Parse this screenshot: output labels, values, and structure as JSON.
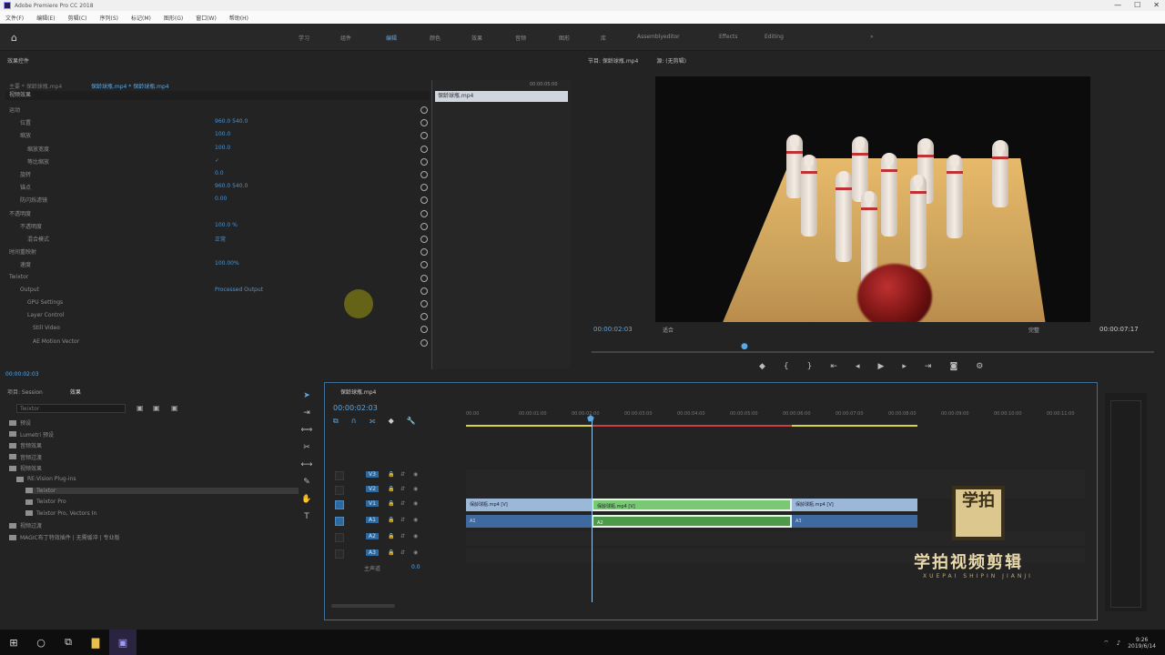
{
  "window": {
    "title": "Adobe Premiere Pro CC 2018",
    "controls": [
      "—",
      "☐",
      "✕"
    ]
  },
  "menu": [
    "文件(F)",
    "编辑(E)",
    "剪辑(C)",
    "序列(S)",
    "标记(M)",
    "图形(G)",
    "窗口(W)",
    "帮助(H)"
  ],
  "workspaces": {
    "tabs": [
      "学习",
      "组件",
      "编辑",
      "颜色",
      "效果",
      "音频",
      "图形",
      "库",
      "Assemblyeditor",
      "Effects",
      "Editing"
    ],
    "active_index": 2
  },
  "effect_controls": {
    "title": "效果控件",
    "source_clip": "主要 * 保龄球瓶.mp4",
    "sequence_clip": "保龄球瓶.mp4 * 保龄球瓶.mp4",
    "section": "视频效果",
    "rows": [
      {
        "label": "运动",
        "value": ""
      },
      {
        "label": "位置",
        "value": "960.0   540.0"
      },
      {
        "label": "缩放",
        "value": "100.0"
      },
      {
        "label": "缩放宽度",
        "value": "100.0"
      },
      {
        "label": "等比缩放",
        "value": "✓"
      },
      {
        "label": "旋转",
        "value": "0.0"
      },
      {
        "label": "锚点",
        "value": "960.0   540.0"
      },
      {
        "label": "防闪烁滤镜",
        "value": "0.00"
      },
      {
        "label": "不透明度",
        "value": ""
      },
      {
        "label": "不透明度",
        "value": "100.0 %"
      },
      {
        "label": "混合模式",
        "value": "正常"
      },
      {
        "label": "时间重映射",
        "value": ""
      },
      {
        "label": "速度",
        "value": "100.00%"
      },
      {
        "label": "Twixtor",
        "value": ""
      },
      {
        "label": "Output",
        "value": "Processed Output"
      },
      {
        "label": "GPU Settings",
        "value": ""
      },
      {
        "label": "Layer Control",
        "value": ""
      },
      {
        "label": "Still Video",
        "value": ""
      },
      {
        "label": "AE Motion Vector",
        "value": ""
      }
    ],
    "timecode": "00:00:02:03",
    "mini_clip": "保龄球瓶.mp4",
    "mini_timecode": "00:00:05:00"
  },
  "program": {
    "tab": "节目: 保龄球瓶.mp4",
    "tab2": "源: (无剪辑)",
    "timecode_in": "00:00:02:03",
    "fit": "适合",
    "quality": "完整",
    "duration": "00:00:07:17"
  },
  "project": {
    "tabs": [
      "项目: Session",
      "效果"
    ],
    "search_placeholder": "Twixtor",
    "items": [
      "预设",
      "Lumetri 预设",
      "音频效果",
      "音频过渡",
      "视频效果",
      "RE:Vision Plug-ins",
      "Twixtor",
      "Twixtor Pro",
      "Twixtor Pro, Vectors In",
      "视频过渡",
      "MAGIC布丁特效插件 | 无需缓冲 | 专业版"
    ]
  },
  "timeline": {
    "title": "保龄球瓶.mp4",
    "timecode": "00:00:02:03",
    "ruler": [
      "00:00",
      "00:00:01:00",
      "00:00:02:00",
      "00:00:03:00",
      "00:00:04:00",
      "00:00:05:00",
      "00:00:06:00",
      "00:00:07:00",
      "00:00:08:00",
      "00:00:09:00",
      "00:00:10:00",
      "00:00:11:00"
    ],
    "clips": {
      "v1_a": "保龄球瓶.mp4 [V]",
      "v1_b": "保龄球瓶.mp4 [V]",
      "v1_c": "保龄球瓶.mp4 [V]",
      "a1_a": "A1",
      "a1_b": "A2",
      "a1_c": "A3"
    },
    "track_labels": [
      "V3",
      "V2",
      "V1",
      "A1",
      "A2",
      "A3"
    ],
    "master": "主声道",
    "master_value": "0.0"
  },
  "watermark": {
    "logo": "学拍",
    "title": "学拍视频剪辑",
    "subtitle": "XUEPAI SHIPIN JIANJI"
  },
  "taskbar": {
    "time": "9:26",
    "date": "2019/6/14"
  },
  "colors": {
    "accent": "#5aa7e6",
    "clip_blue": "#9cb8d8",
    "clip_green": "#79c873"
  }
}
